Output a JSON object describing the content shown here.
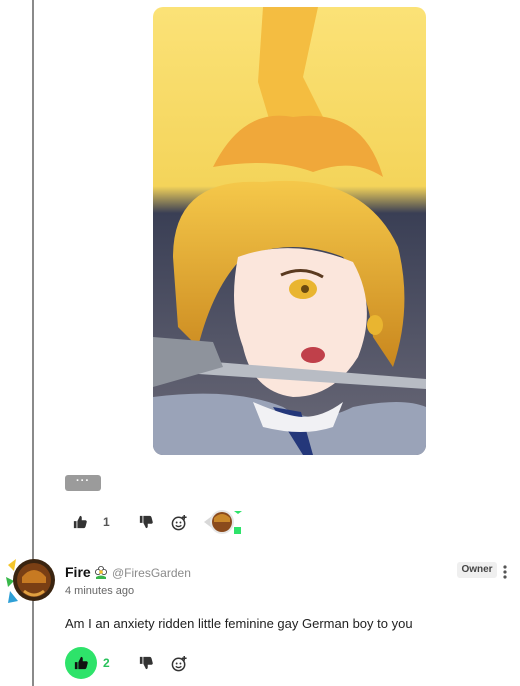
{
  "post": {
    "more_label": "···",
    "likes": "1",
    "icons": {
      "like": "thumbs-up-icon",
      "dislike": "thumbs-down-icon",
      "react": "add-reaction-icon"
    }
  },
  "comment": {
    "author": "Fire",
    "handle": "@FiresGarden",
    "timestamp": "4 minutes ago",
    "badge": "Owner",
    "text": "Am I an anxiety ridden little feminine gay German boy to you",
    "likes": "2"
  },
  "colors": {
    "accent_green": "#2ee36a",
    "thread_line": "#8a8a8a",
    "image_bg": "#f7d85a"
  }
}
